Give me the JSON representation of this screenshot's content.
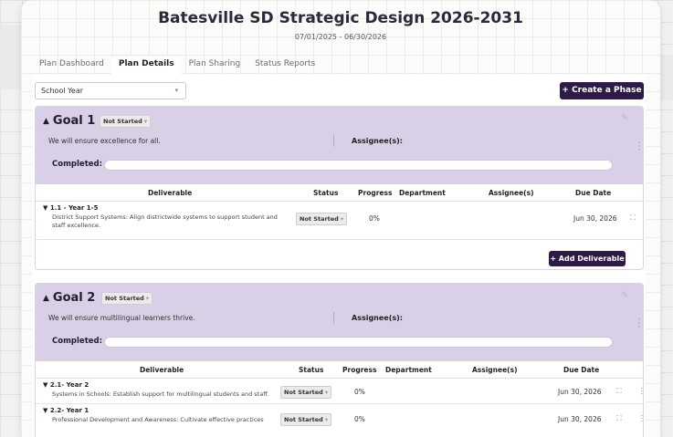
{
  "title": "Batesville SD Strategic Design 2026-2031",
  "date_range": "07/01/2025 - 06/30/2026",
  "tabs": [
    "Plan Dashboard",
    "Plan Details",
    "Plan Sharing",
    "Status Reports"
  ],
  "active_tab": "Plan Details",
  "filter": {
    "value": "School Year"
  },
  "create_phase_label": "+ Create a Phase",
  "labels": {
    "assignee": "Assignee(s):",
    "completed": "Completed:",
    "add_deliverable": "+ Add Deliverable"
  },
  "table_headers": {
    "deliverable": "Deliverable",
    "status": "Status",
    "progress": "Progress",
    "department": "Department",
    "assignees": "Assignee(s)",
    "due_date": "Due Date"
  },
  "goals": [
    {
      "title": "Goal 1",
      "status": "Not Started",
      "description": "We will ensure excellence for all.",
      "completed_fraction": 0,
      "deliverables": [
        {
          "title": "1.1 - Year 1-5",
          "desc_line1": "District Support Systems: Align districtwide systems to support student and",
          "desc_line2": "staff excellence.",
          "status": "Not Started",
          "progress": "0%",
          "due": "Jun 30, 2026"
        }
      ]
    },
    {
      "title": "Goal 2",
      "status": "Not Started",
      "description": "We will ensure multilingual learners thrive.",
      "completed_fraction": 0,
      "deliverables": [
        {
          "title": "2.1- Year 2",
          "desc_line1": "Systems in Schools: Establish support for multilingual students and staff.",
          "status": "Not Started",
          "progress": "0%",
          "due": "Jun 30, 2026"
        },
        {
          "title": "2.2- Year 1",
          "desc_line1": "Professional Development and Awareness: Cultivate effective practices",
          "status": "Not Started",
          "progress": "0%",
          "due": "Jun 30, 2026"
        }
      ]
    }
  ],
  "icons": {
    "collapse": "triangle-up-icon",
    "expand_row": "triangle-down-icon",
    "edit": "pencil-icon",
    "menu": "kebab-icon",
    "open": "expand-icon",
    "dropdown": "chevron-down-icon"
  },
  "colors": {
    "goal_header": "#d9cfe7",
    "primary_button": "#2e1a47"
  }
}
